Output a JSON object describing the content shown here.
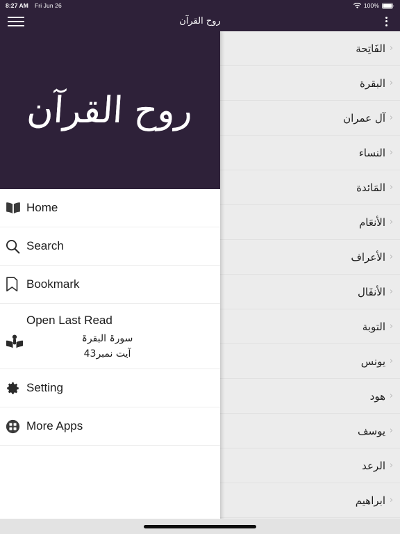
{
  "status_bar": {
    "time": "8:27 AM",
    "date": "Fri Jun 26",
    "battery_percent": "100%",
    "wifi_icon": "wifi-icon",
    "battery_icon": "battery-icon"
  },
  "nav_bar": {
    "title": "روح القرآن",
    "menu_icon": "hamburger-icon",
    "overflow_icon": "overflow-menu-icon"
  },
  "drawer": {
    "logo_text": "روح القرآن",
    "items": [
      {
        "label": "Home",
        "icon": "open-book-icon"
      },
      {
        "label": "Search",
        "icon": "search-icon"
      },
      {
        "label": "Bookmark",
        "icon": "bookmark-icon"
      }
    ],
    "last_read": {
      "title": "Open Last Read",
      "icon": "person-reading-icon",
      "surah": "سورۃ البقرۃ",
      "ayat": "آیت نمبر43"
    },
    "footer_items": [
      {
        "label": "Setting",
        "icon": "gear-icon"
      },
      {
        "label": "More Apps",
        "icon": "apps-grid-icon"
      }
    ]
  },
  "surah_list": {
    "chevron_icon": "chevron-right-icon",
    "items": [
      {
        "name": "الفَاتِحة"
      },
      {
        "name": "البقرة"
      },
      {
        "name": "آل عمران"
      },
      {
        "name": "النساء"
      },
      {
        "name": "المَائدة"
      },
      {
        "name": "الأنعَام"
      },
      {
        "name": "الأعراف"
      },
      {
        "name": "الأنفَال"
      },
      {
        "name": "التوبة"
      },
      {
        "name": "يونس"
      },
      {
        "name": "هود"
      },
      {
        "name": "يوسف"
      },
      {
        "name": "الرعد"
      },
      {
        "name": "ابراهيم"
      }
    ]
  },
  "colors": {
    "primary": "#2E2139",
    "list_bg": "#ECECEC",
    "drawer_bg": "#FFFFFF",
    "divider": "#E1E1E1",
    "chevron": "#B9B9B9"
  }
}
